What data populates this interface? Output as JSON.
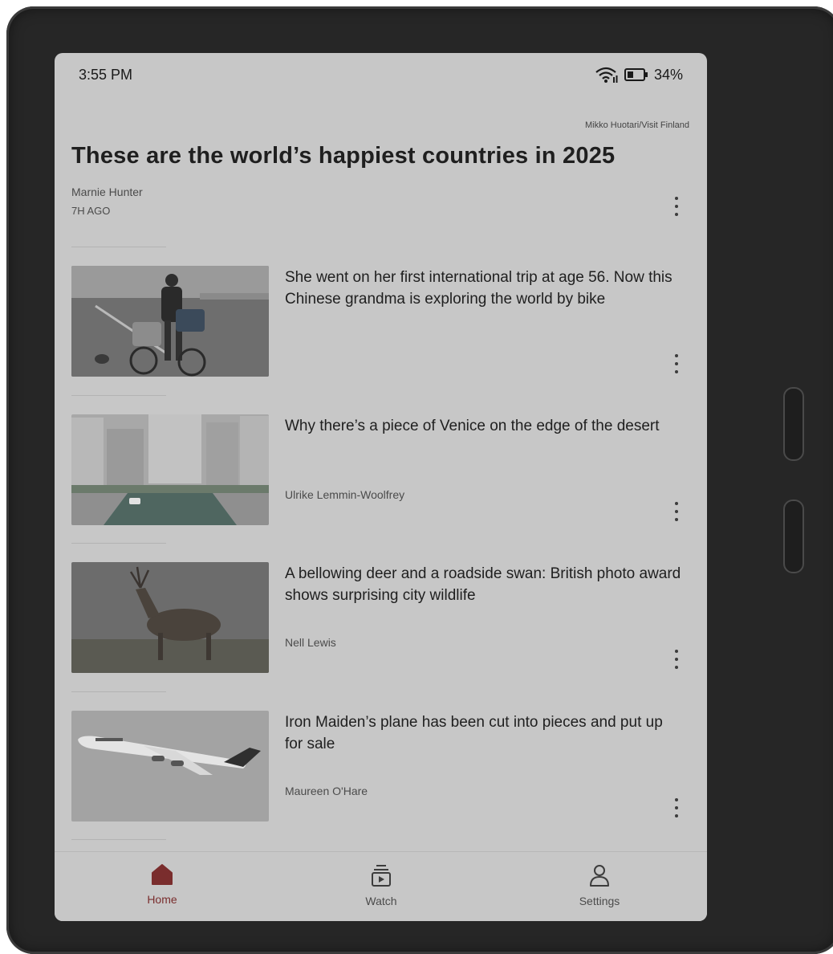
{
  "status": {
    "time": "3:55 PM",
    "battery": "34%"
  },
  "hero": {
    "credit": "Mikko Huotari/Visit Finland",
    "title": "These are the world’s happiest countries in 2025",
    "author": "Marnie Hunter",
    "time": "7H AGO"
  },
  "articles": [
    {
      "title": "She went on her first international trip at age 56. Now this Chinese grandma is exploring the world by bike",
      "author": "",
      "image": "cyclist-photo"
    },
    {
      "title": "Why there’s a piece of Venice on the edge of the desert",
      "author": "Ulrike Lemmin-Woolfrey",
      "image": "canal-photo"
    },
    {
      "title": "A bellowing deer and a roadside swan: British photo award shows surprising city wildlife",
      "author": "Nell Lewis",
      "image": "deer-photo"
    },
    {
      "title": "Iron Maiden’s plane has been cut into pieces and put up for sale",
      "author": "Maureen O'Hare",
      "image": "airplane-photo"
    }
  ],
  "nav": {
    "home": "Home",
    "watch": "Watch",
    "settings": "Settings"
  },
  "colors": {
    "accent": "#7a2d2d",
    "screen": "#c7c7c7",
    "bezel": "#262626"
  }
}
